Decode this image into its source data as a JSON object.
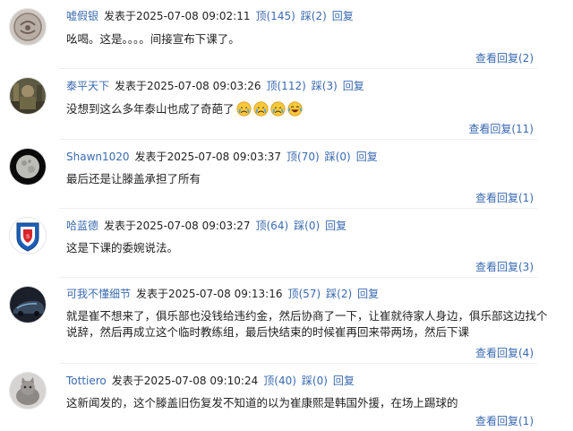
{
  "labels": {
    "posted_prefix": "发表于",
    "up": "顶",
    "down": "踩",
    "reply": "回复",
    "view_replies": "查看回复"
  },
  "comments": [
    {
      "user": "嘘假银",
      "time": "2025-07-08 09:02:11",
      "up": "(145)",
      "down": "(2)",
      "lines": [
        "吆喝。这是。。。。间接宣布下课了。"
      ],
      "replies": "(2)",
      "avatar": "gray-round-logo"
    },
    {
      "user": "泰平天下",
      "time": "2025-07-08 09:03:26",
      "up": "(112)",
      "down": "(3)",
      "lines": [
        "没想到这么多年泰山也成了奇葩了"
      ],
      "emojis": [
        "crying-face-icon",
        "crying-face-icon",
        "crying-face-icon",
        "laughing-tears-icon"
      ],
      "replies": "(11)",
      "avatar": "soldier-photo"
    },
    {
      "user": "Shawn1020",
      "time": "2025-07-08 09:03:37",
      "up": "(70)",
      "down": "(0)",
      "lines": [
        "最后还是让滕盖承担了所有"
      ],
      "replies": "(1)",
      "avatar": "moon-photo"
    },
    {
      "user": "哈蓝德",
      "time": "2025-07-08 09:03:27",
      "up": "(64)",
      "down": "(0)",
      "lines": [
        "这是下课的委婉说法。"
      ],
      "replies": "(3)",
      "avatar": "blue-club-crest"
    },
    {
      "user": "可我不懂细节",
      "time": "2025-07-08 09:13:16",
      "up": "(57)",
      "down": "(2)",
      "lines": [
        "就是崔不想来了，俱乐部也没钱给违约金，然后协商了一下，让崔就待家人身边，俱乐部这边找个",
        "说辞，然后再成立这个临时教练组，最后快结束的时候崔再回来带两场，然后下课"
      ],
      "replies": "(4)",
      "avatar": "dark-car-photo"
    },
    {
      "user": "Tottiero",
      "time": "2025-07-08 09:10:24",
      "up": "(40)",
      "down": "(0)",
      "lines": [
        "这新闻发的，这个滕盖旧伤复发不知道的以为崔康熙是韩国外援，在场上踢球的"
      ],
      "replies": "(1)",
      "avatar": "gray-cat-photo"
    }
  ],
  "colors": {
    "link": "#3a6ab0",
    "text": "#222222",
    "separator": "#eceff3"
  }
}
